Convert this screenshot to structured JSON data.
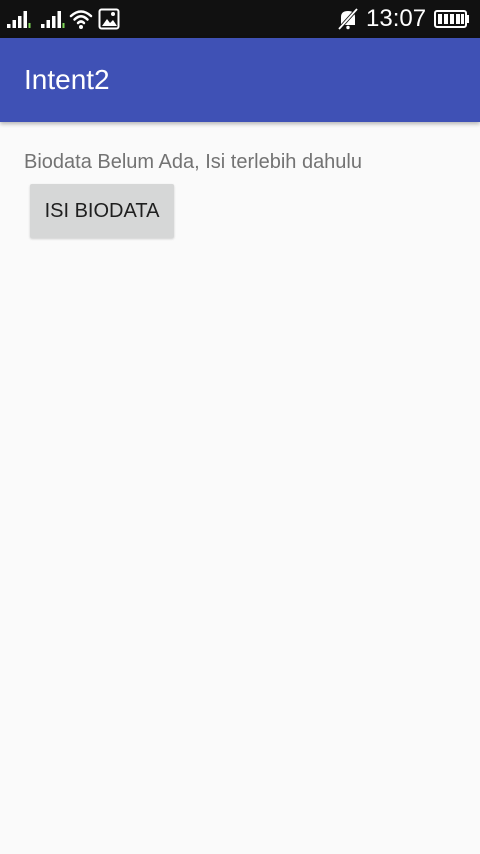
{
  "status_bar": {
    "time": "13:07",
    "icons": [
      "signal-icon",
      "signal-icon",
      "wifi-icon",
      "gallery-icon",
      "mute-icon",
      "battery-icon"
    ]
  },
  "app_bar": {
    "title": "Intent2",
    "color": "#3f51b5"
  },
  "content": {
    "message": "Biodata Belum Ada, Isi terlebih dahulu",
    "button_label": "ISI BIODATA"
  }
}
